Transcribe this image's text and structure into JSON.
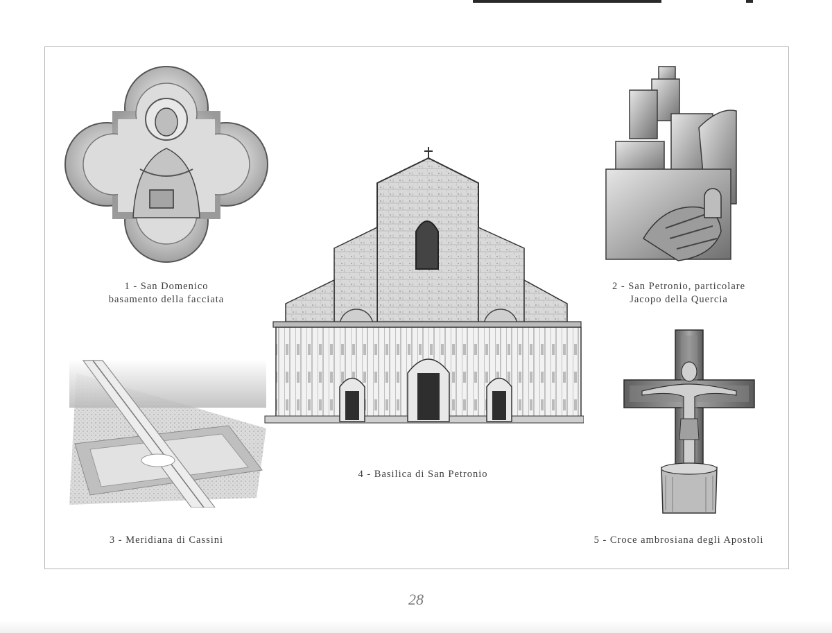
{
  "page_number": "28",
  "figures": [
    {
      "id": 1,
      "caption_lines": [
        "1 - San Domenico",
        "basamento della facciata"
      ],
      "icon": "quatrefoil-relief-san-domenico"
    },
    {
      "id": 2,
      "caption_lines": [
        "2 - San Petronio, particolare",
        "Jacopo della Quercia"
      ],
      "icon": "sculpted-hands-city-model"
    },
    {
      "id": 3,
      "caption_lines": [
        "3 - Meridiana di Cassini"
      ],
      "icon": "meridian-floor-line"
    },
    {
      "id": 4,
      "caption_lines": [
        "4 - Basilica di San Petronio"
      ],
      "icon": "basilica-facade"
    },
    {
      "id": 5,
      "caption_lines": [
        "5 - Croce ambrosiana degli Apostoli"
      ],
      "icon": "crucifix-cross"
    }
  ]
}
